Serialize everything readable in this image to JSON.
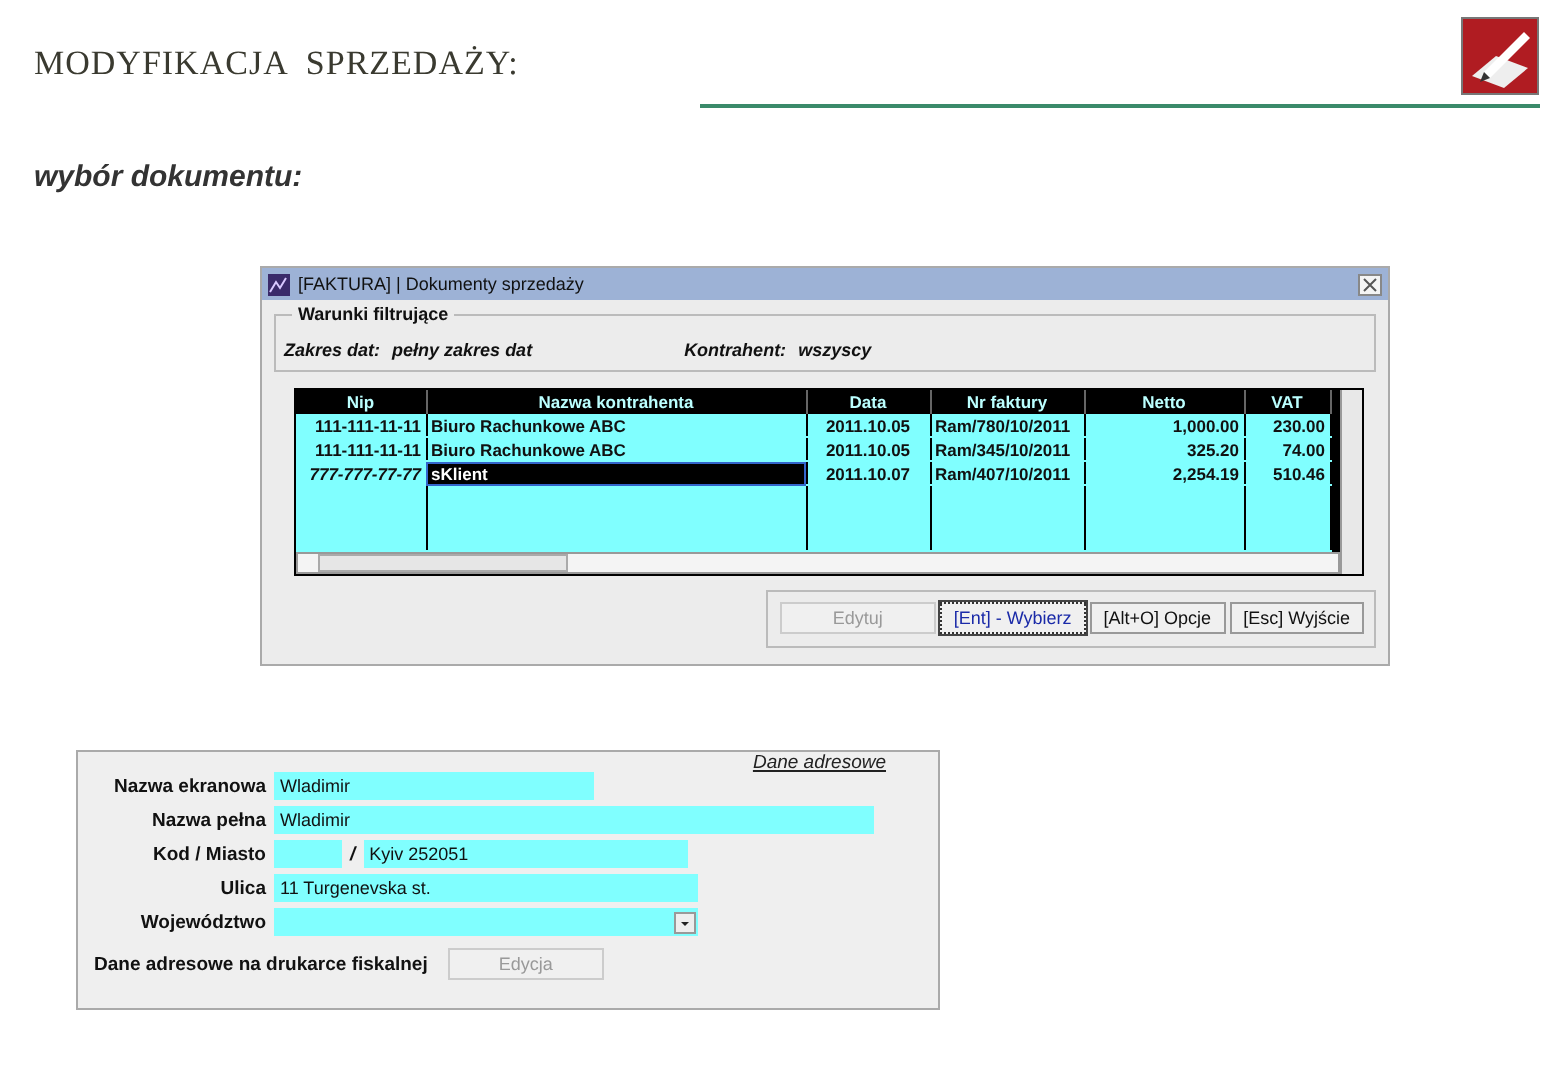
{
  "slide": {
    "title": "MODYFIKACJA  SPRZEDAŻY:",
    "subtitle": "wybór dokumentu:"
  },
  "window": {
    "title": "[FAKTURA]  |  Dokumenty sprzedaży",
    "filter": {
      "legend": "Warunki filtrujące",
      "date_label": "Zakres dat:",
      "date_value": "pełny zakres dat",
      "client_label": "Kontrahent:",
      "client_value": "wszyscy"
    },
    "table": {
      "columns": [
        "Nip",
        "Nazwa kontrahenta",
        "Data",
        "Nr faktury",
        "Netto",
        "VAT"
      ],
      "rows": [
        {
          "cells": [
            "111-111-11-11",
            "Biuro Rachunkowe ABC",
            "2011.10.05",
            "Ram/780/10/2011",
            "1,000.00",
            "230.00"
          ],
          "selected": false
        },
        {
          "cells": [
            "111-111-11-11",
            "Biuro Rachunkowe ABC",
            "2011.10.05",
            "Ram/345/10/2011",
            "325.20",
            "74.00"
          ],
          "selected": false
        },
        {
          "cells": [
            "777-777-77-77",
            "sKlient",
            "2011.10.07",
            "Ram/407/10/2011",
            "2,254.19",
            "510.46"
          ],
          "selected": true
        }
      ]
    },
    "buttons": [
      {
        "label": "Edytuj",
        "disabled": true,
        "focused": false
      },
      {
        "label": "[Ent] - Wybierz",
        "disabled": false,
        "focused": true
      },
      {
        "label": "[Alt+O]  Opcje",
        "disabled": false,
        "focused": false
      },
      {
        "label": "[Esc]  Wyjście",
        "disabled": false,
        "focused": false
      }
    ]
  },
  "form": {
    "section_link": "Dane adresowe",
    "fields": [
      {
        "kind": "short",
        "label": "Nazwa ekranowa",
        "value": "Wladimir"
      },
      {
        "kind": "wide",
        "label": "Nazwa pełna",
        "value": "Wladimir"
      },
      {
        "kind": "pair",
        "label": "Kod / Miasto",
        "separator": "/",
        "value": "Kyiv 252051"
      },
      {
        "kind": "medium",
        "label": "Ulica",
        "value": "11 Turgenevska st."
      },
      {
        "kind": "select",
        "label": "Województwo"
      }
    ],
    "footer_label": "Dane adresowe na drukarce fiskalnej",
    "footer_button": {
      "label": "Edycja",
      "disabled": true
    }
  }
}
